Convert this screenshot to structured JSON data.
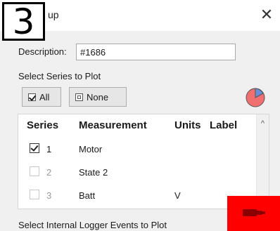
{
  "step_badge": "3",
  "window": {
    "title": "up",
    "close_glyph": "✕"
  },
  "description": {
    "label": "Description:",
    "value": "#1686"
  },
  "series_section": {
    "label": "Select Series to Plot",
    "all_button": "All",
    "none_button": "None",
    "pie_icon": "pie-chart-icon"
  },
  "table": {
    "headers": {
      "series": "Series",
      "measurement": "Measurement",
      "units": "Units",
      "label": "Label"
    },
    "rows": [
      {
        "number": "1",
        "measurement": "Motor",
        "units": "",
        "checked": true,
        "enabled": true
      },
      {
        "number": "2",
        "measurement": "State 2",
        "units": "",
        "checked": false,
        "enabled": false
      },
      {
        "number": "3",
        "measurement": "Batt",
        "units": "V",
        "checked": false,
        "enabled": false
      }
    ]
  },
  "events_section": {
    "label": "Select Internal Logger Events to Plot"
  },
  "logger_icon": "logger-device-icon",
  "colors": {
    "badge_border": "#000000",
    "pie_red": "#f07070",
    "pie_blue": "#6a8fd8",
    "logger_block": "#ff0000",
    "logger_device": "#8b0000"
  }
}
